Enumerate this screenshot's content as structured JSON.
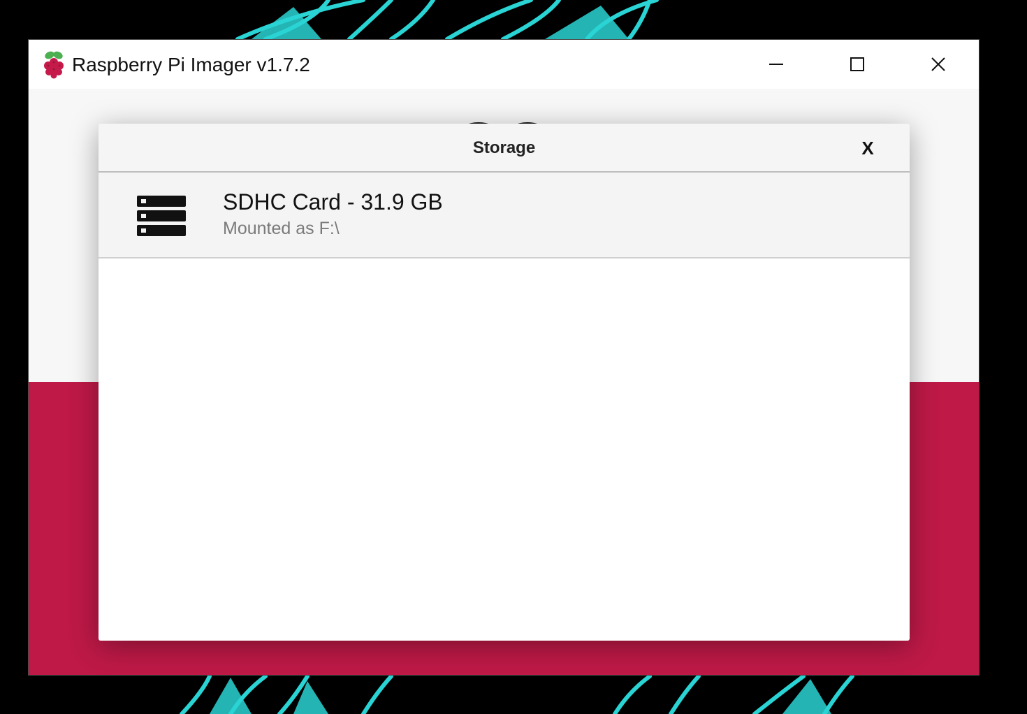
{
  "window": {
    "title": "Raspberry Pi Imager v1.7.2",
    "app_icon": "raspberry-icon",
    "controls": {
      "minimize_icon": "minimize-icon",
      "maximize_icon": "maximize-icon",
      "close_icon": "close-icon"
    }
  },
  "theme": {
    "accent": "#c51a4a",
    "wallpaper_art": "#2ad4d4"
  },
  "dialog": {
    "title": "Storage",
    "close_label": "X",
    "items": [
      {
        "icon": "storage-drive-icon",
        "name": "SDHC Card - 31.9 GB",
        "subtitle": "Mounted as F:\\"
      }
    ]
  }
}
